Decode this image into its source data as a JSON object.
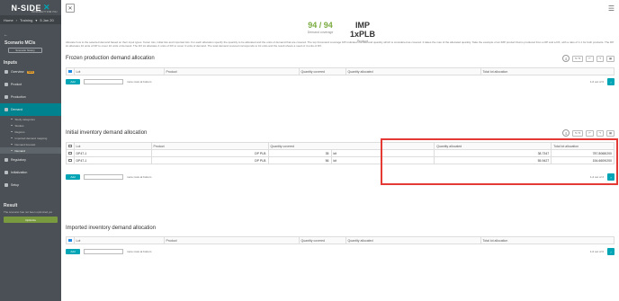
{
  "topbar": {
    "home": "Home",
    "training": "Training",
    "date": "5 Jan 20"
  },
  "logo": {
    "name": "N-SIDE",
    "tagline": "PROBABILITY FOR YOU"
  },
  "sidebar": {
    "scenario_title": "Scenario MCIs",
    "scenario_button": "Scenario history",
    "inputs_title": "Inputs",
    "items": [
      {
        "label": "Overview",
        "badge": "NEW"
      },
      {
        "label": "Product"
      },
      {
        "label": "Production"
      },
      {
        "label": "Demand"
      }
    ],
    "demand_sub": [
      "Study categories",
      "Studies",
      "Regions",
      "Imported demand mapping",
      "Demand forecast",
      "Demand"
    ],
    "items2": [
      {
        "label": "Regulatory"
      },
      {
        "label": "Initialization"
      },
      {
        "label": "Setup"
      }
    ],
    "result_title": "Result",
    "result_desc": "The scenario has not been optimized yet",
    "result_button": "Optimize"
  },
  "kpis": [
    {
      "value": "94 / 94",
      "label": "Demand coverage",
      "color": "#7aab3f"
    },
    {
      "value": "IMP 1xPLB",
      "label": "Product",
      "color": "#333333"
    }
  ],
  "description": "Allocate how to the selected demand based on their input types: frozen lots, initial lots and imported lots. For each allocation specify the quantity to be allocated and the units of demand that are covered. The top frozenand coverage KPI indicates the demand quantity which is considered as covered. It takes the max of the allocated quantity. Take the example of an IMP product that is produced from a DP and a DX, with a ratio of 1:1 for both products. The DP lot allocates 10 units of DP to cover 10 units of demand. The DX lot allocates 4 units of DX to cover 3 units of demand. The total demand covered corresponds to 10 units and the result shows a need of 4 units of DX.",
  "sections": {
    "frozen": {
      "title": "Frozen production demand allocation",
      "columns": [
        "Lot",
        "Product",
        "Quantity covered",
        "Quantity allocated",
        "Total lot allocation"
      ],
      "add": "Add",
      "more": "more rows at bottom",
      "pagination": "1-0 out of 0",
      "col_count": "5 / 5"
    },
    "initial": {
      "title": "Initial inventory demand allocation",
      "columns": [
        "Lot",
        "Product",
        "Quantity covered",
        "Quantity allocated",
        "Total lot allocation"
      ],
      "rows": [
        {
          "lot": "DP47-1",
          "product": "DP PLB",
          "qty_covered": "35",
          "unit": "kit",
          "qty_alloc": "38.7347",
          "total": "787.8068/200"
        },
        {
          "lot": "DP47-1",
          "product": "DP PLB",
          "qty_covered": "56",
          "unit": "kit",
          "qty_alloc": "55.9427",
          "total": "154.6609/200"
        }
      ],
      "add": "Add",
      "more": "more rows at bottom",
      "pagination": "1-2 out of 2",
      "col_count": "5 / 5"
    },
    "imported": {
      "title": "Imported inventory demand allocation",
      "columns": [
        "Lot",
        "Product",
        "Quantity covered",
        "Quantity allocated",
        "Total lot allocation"
      ],
      "add": "Add",
      "more": "more rows at bottom",
      "pagination": "1-0 out of 0",
      "col_count": "5 / 5"
    }
  }
}
